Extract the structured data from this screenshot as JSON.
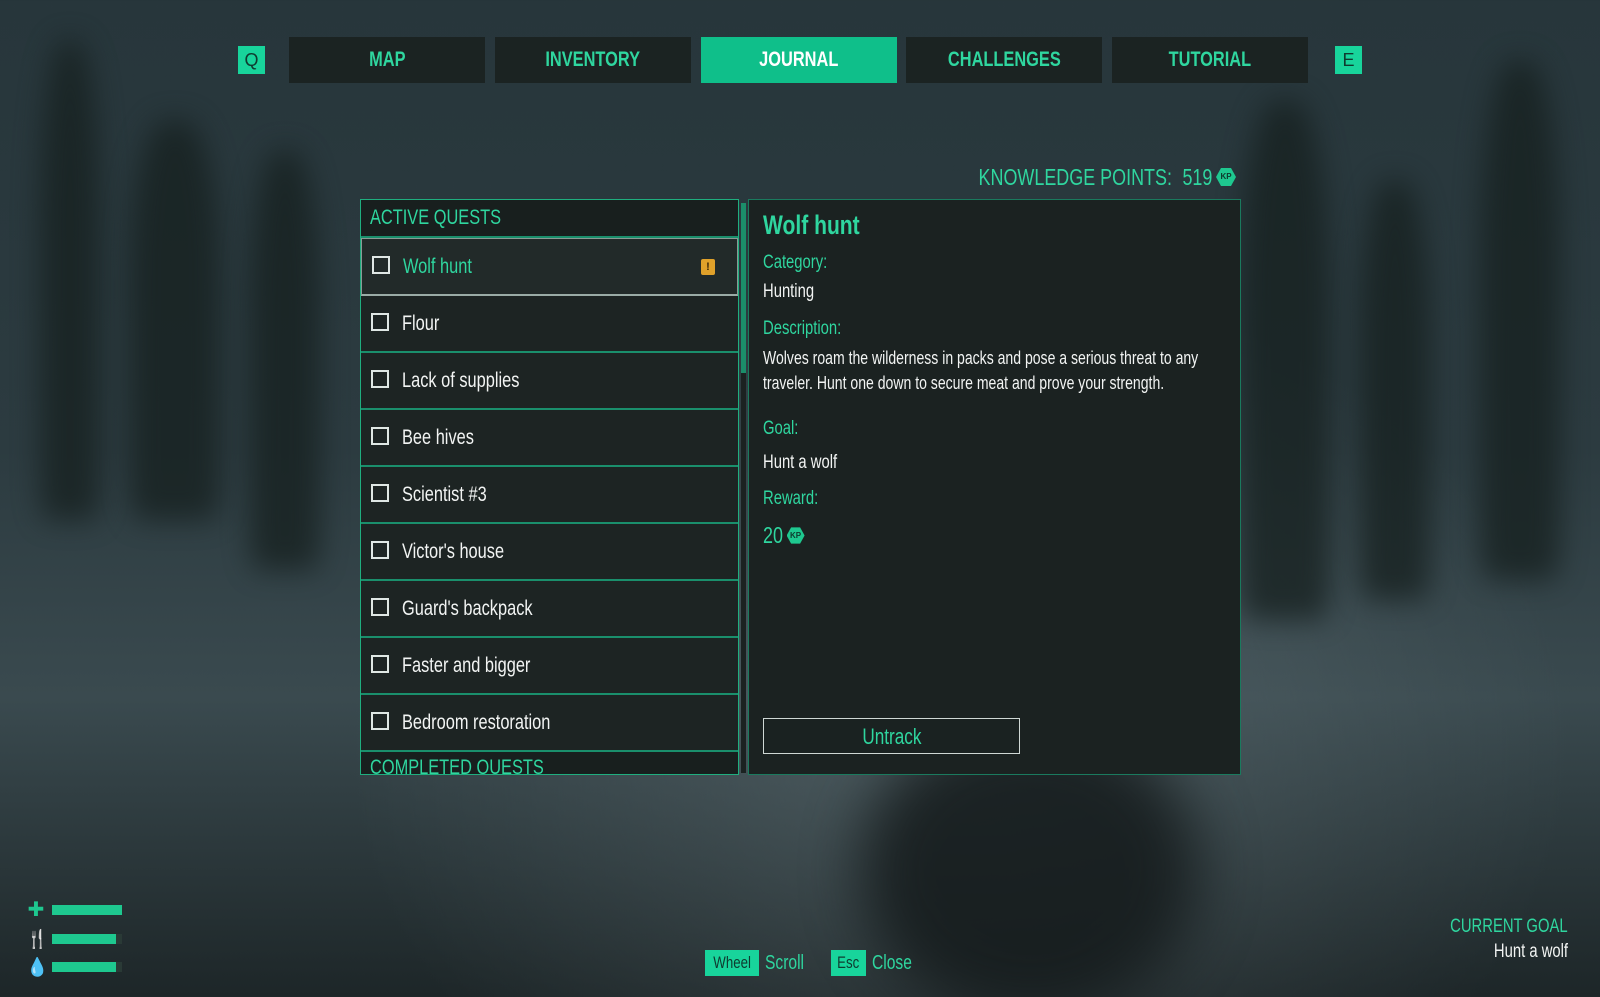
{
  "tabs": {
    "left_key": "Q",
    "right_key": "E",
    "items": [
      {
        "label": "MAP",
        "active": false
      },
      {
        "label": "INVENTORY",
        "active": false
      },
      {
        "label": "JOURNAL",
        "active": true
      },
      {
        "label": "CHALLENGES",
        "active": false
      },
      {
        "label": "TUTORIAL",
        "active": false
      }
    ]
  },
  "knowledge": {
    "label": "KNOWLEDGE POINTS:",
    "value": "519",
    "icon_text": "KP"
  },
  "quests": {
    "active_header": "ACTIVE QUESTS",
    "completed_header": "COMPLETED QUESTS",
    "items": [
      {
        "label": "Wolf hunt",
        "selected": true,
        "tracked_icon": "!"
      },
      {
        "label": "Flour",
        "selected": false
      },
      {
        "label": "Lack of supplies",
        "selected": false
      },
      {
        "label": "Bee hives",
        "selected": false
      },
      {
        "label": "Scientist #3",
        "selected": false
      },
      {
        "label": "Victor's house",
        "selected": false
      },
      {
        "label": "Guard's backpack",
        "selected": false
      },
      {
        "label": "Faster and bigger",
        "selected": false
      },
      {
        "label": "Bedroom restoration",
        "selected": false
      }
    ]
  },
  "detail": {
    "title": "Wolf hunt",
    "category_label": "Category:",
    "category_value": "Hunting",
    "description_label": "Description:",
    "description_line1": "Wolves roam the wilderness in packs and pose a serious threat to any",
    "description_line2": "traveler. Hunt one down to secure meat and prove your strength.",
    "goal_label": "Goal:",
    "goal_value": "Hunt a wolf",
    "reward_label": "Reward:",
    "reward_value": "20",
    "reward_icon_text": "KP",
    "untrack_label": "Untrack"
  },
  "status": {
    "health_icon": "plus-icon",
    "health_level": 1.0,
    "food_icon": "fork-knife-icon",
    "food_level": 0.92,
    "water_icon": "water-drop-icon",
    "water_level": 0.92
  },
  "hints": {
    "wheel_key": "Wheel",
    "wheel_text": "Scroll",
    "esc_key": "Esc",
    "esc_text": "Close"
  },
  "current_goal": {
    "label": "CURRENT GOAL",
    "value": "Hunt a wolf"
  },
  "colors": {
    "accent": "#2fd69f",
    "active_tab": "#0fbf8a",
    "panel": "#1b2221",
    "track_icon": "#e0a12a"
  }
}
